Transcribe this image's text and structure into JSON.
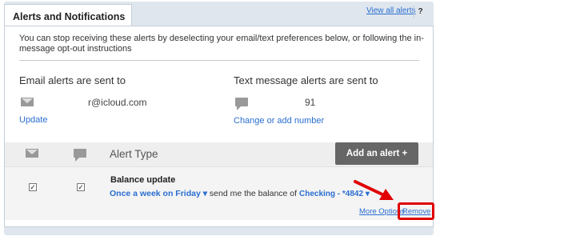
{
  "tab": {
    "title": "Alerts and Notifications"
  },
  "header_links": {
    "view_all": "View all alerts",
    "help": "?"
  },
  "intro_text": "You can stop receiving these alerts by deselecting your email/text preferences below, or following the in-message opt-out instructions",
  "email": {
    "title": "Email alerts are sent to",
    "value": "r@icloud.com",
    "update_link": "Update"
  },
  "text": {
    "title": "Text message alerts are sent to",
    "value": "91",
    "change_link": "Change or add number"
  },
  "table": {
    "alert_type_label": "Alert Type",
    "add_button": "Add an alert  +"
  },
  "alert": {
    "title": "Balance update",
    "frequency": "Once a week on Friday ▾",
    "middle_text": "send me the balance of",
    "account": "Checking - *4842 ▾",
    "email_checked": "✓",
    "text_checked": "✓",
    "more_options": "More Options",
    "remove": "Remove"
  },
  "annotation_color": "#e00000"
}
